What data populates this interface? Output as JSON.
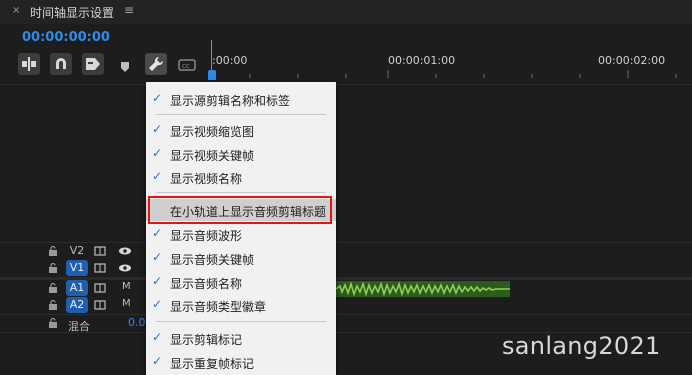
{
  "panel": {
    "close": "×",
    "title": "时间轴显示设置",
    "menu": "≡"
  },
  "timecode": "00:00:00:00",
  "toolbar": {
    "icons": [
      "insert-snap-icon",
      "magnet-icon",
      "linked-selection-icon",
      "add-marker-icon",
      "wrench-icon",
      "captions-icon"
    ]
  },
  "ruler": {
    "labels": [
      ":00:00",
      "00:00:01:00",
      "00:00:02:00"
    ]
  },
  "tracks": {
    "v2": {
      "name": "V2"
    },
    "v1": {
      "name": "V1"
    },
    "a1": {
      "name": "A1",
      "m": "M"
    },
    "a2": {
      "name": "A2",
      "m": "M"
    },
    "mix": {
      "label": "混合",
      "value": "0.0"
    }
  },
  "menu": {
    "items": [
      {
        "label": "显示源剪辑名称和标签",
        "checked": true
      },
      {
        "label": "显示视频缩览图",
        "checked": true
      },
      {
        "label": "显示视频关键帧",
        "checked": true
      },
      {
        "label": "显示视频名称",
        "checked": true
      },
      {
        "label": "在小轨道上显示音频剪辑标题",
        "checked": false
      },
      {
        "label": "显示音频波形",
        "checked": true
      },
      {
        "label": "显示音频关键帧",
        "checked": true
      },
      {
        "label": "显示音频名称",
        "checked": true
      },
      {
        "label": "显示音频类型徽章",
        "checked": true
      },
      {
        "label": "显示剪辑标记",
        "checked": true
      },
      {
        "label": "显示重复帧标记",
        "checked": true
      }
    ],
    "check": "✓"
  },
  "watermark": "sanlang2021",
  "colors": {
    "accent": "#2d8ceb",
    "highlight_box": "#e01515",
    "audio_clip": "#2d5b1d",
    "waveform": "#8fcf5a"
  }
}
